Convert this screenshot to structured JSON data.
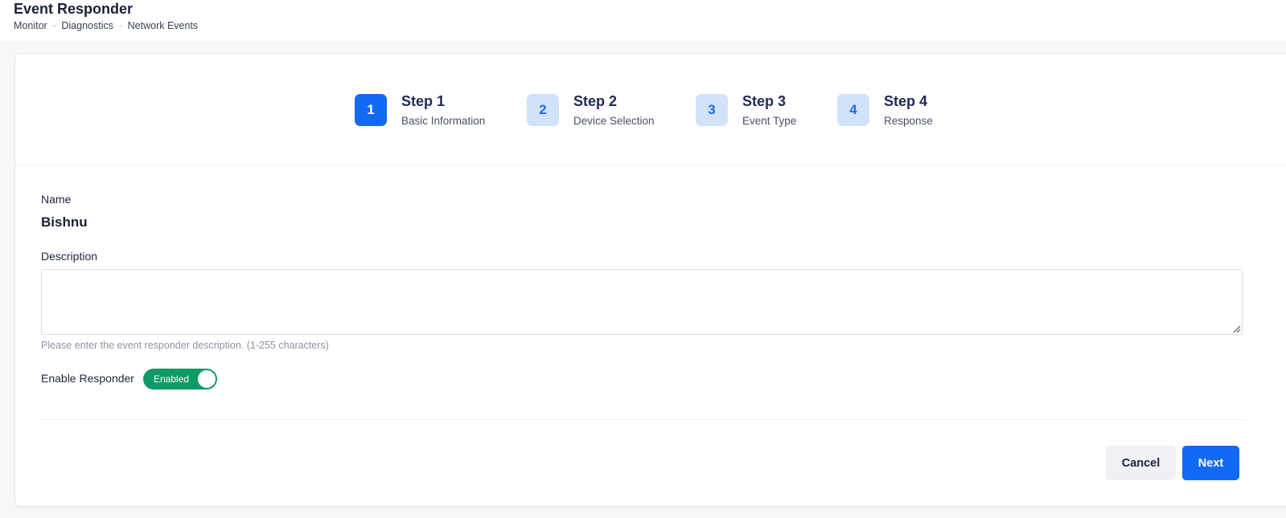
{
  "header": {
    "title": "Event Responder",
    "breadcrumb": [
      "Monitor",
      "Diagnostics",
      "Network Events"
    ],
    "breadcrumb_separator": "-"
  },
  "stepper": {
    "steps": [
      {
        "number": "1",
        "title": "Step 1",
        "subtitle": "Basic Information",
        "active": true
      },
      {
        "number": "2",
        "title": "Step 2",
        "subtitle": "Device Selection",
        "active": false
      },
      {
        "number": "3",
        "title": "Step 3",
        "subtitle": "Event Type",
        "active": false
      },
      {
        "number": "4",
        "title": "Step 4",
        "subtitle": "Response",
        "active": false
      }
    ]
  },
  "form": {
    "name_label": "Name",
    "name_value": "Bishnu",
    "description_label": "Description",
    "description_value": "",
    "description_help": "Please enter the event responder description. (1-255 characters)",
    "enable_label": "Enable Responder",
    "enable_state_label": "Enabled"
  },
  "actions": {
    "cancel_label": "Cancel",
    "next_label": "Next"
  },
  "colors": {
    "primary": "#1269f5",
    "step_inactive_bg": "#d3e2fb",
    "toggle_on": "#0e9a66"
  }
}
